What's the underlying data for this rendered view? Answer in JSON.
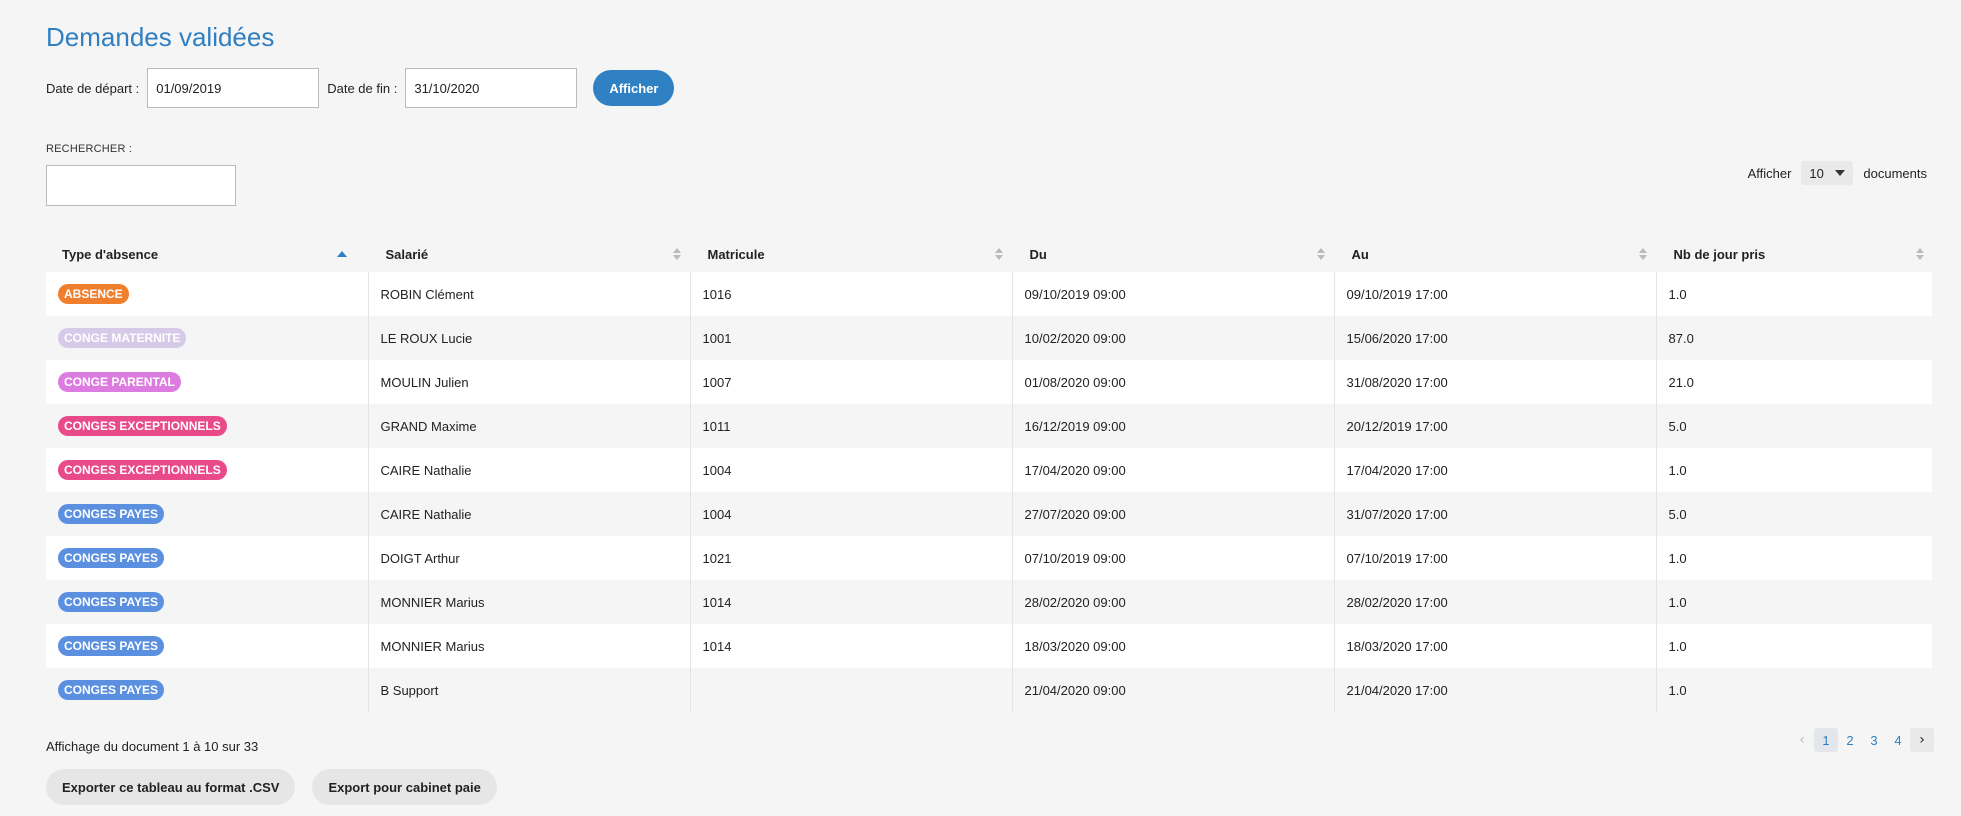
{
  "page_title": "Demandes validées",
  "filters": {
    "start_label": "Date de départ :",
    "start_value": "01/09/2019",
    "end_label": "Date de fin :",
    "end_value": "31/10/2020",
    "submit_label": "Afficher"
  },
  "search": {
    "label": "RECHERCHER :",
    "value": ""
  },
  "page_size": {
    "prefix": "Afficher",
    "value": "10",
    "suffix": "documents"
  },
  "columns": [
    "Type d'absence",
    "Salarié",
    "Matricule",
    "Du",
    "Au",
    "Nb de jour pris"
  ],
  "badge_colors": {
    "ABSENCE": "#f07f2d",
    "CONGE MATERNITE": "#d7c9e8",
    "CONGE PARENTAL": "#dc7ce0",
    "CONGES EXCEPTIONNELS": "#e84a8a",
    "CONGES PAYES": "#5b8fe0"
  },
  "rows": [
    {
      "type": "ABSENCE",
      "salarie": "ROBIN Clément",
      "matricule": "1016",
      "du": "09/10/2019 09:00",
      "au": "09/10/2019 17:00",
      "nb": "1.0"
    },
    {
      "type": "CONGE MATERNITE",
      "salarie": "LE ROUX Lucie",
      "matricule": "1001",
      "du": "10/02/2020 09:00",
      "au": "15/06/2020 17:00",
      "nb": "87.0"
    },
    {
      "type": "CONGE PARENTAL",
      "salarie": "MOULIN Julien",
      "matricule": "1007",
      "du": "01/08/2020 09:00",
      "au": "31/08/2020 17:00",
      "nb": "21.0"
    },
    {
      "type": "CONGES EXCEPTIONNELS",
      "salarie": "GRAND Maxime",
      "matricule": "1011",
      "du": "16/12/2019 09:00",
      "au": "20/12/2019 17:00",
      "nb": "5.0"
    },
    {
      "type": "CONGES EXCEPTIONNELS",
      "salarie": "CAIRE Nathalie",
      "matricule": "1004",
      "du": "17/04/2020 09:00",
      "au": "17/04/2020 17:00",
      "nb": "1.0"
    },
    {
      "type": "CONGES PAYES",
      "salarie": "CAIRE Nathalie",
      "matricule": "1004",
      "du": "27/07/2020 09:00",
      "au": "31/07/2020 17:00",
      "nb": "5.0"
    },
    {
      "type": "CONGES PAYES",
      "salarie": "DOIGT Arthur",
      "matricule": "1021",
      "du": "07/10/2019 09:00",
      "au": "07/10/2019 17:00",
      "nb": "1.0"
    },
    {
      "type": "CONGES PAYES",
      "salarie": "MONNIER Marius",
      "matricule": "1014",
      "du": "28/02/2020 09:00",
      "au": "28/02/2020 17:00",
      "nb": "1.0"
    },
    {
      "type": "CONGES PAYES",
      "salarie": "MONNIER Marius",
      "matricule": "1014",
      "du": "18/03/2020 09:00",
      "au": "18/03/2020 17:00",
      "nb": "1.0"
    },
    {
      "type": "CONGES PAYES",
      "salarie": "B Support",
      "matricule": "",
      "du": "21/04/2020 09:00",
      "au": "21/04/2020 17:00",
      "nb": "1.0"
    }
  ],
  "info": "Affichage du document 1 à 10 sur 33",
  "pagination": {
    "pages": [
      "1",
      "2",
      "3",
      "4"
    ],
    "current": "1",
    "prev_icon": "chevron-left-icon",
    "next_icon": "chevron-right-icon"
  },
  "exports": {
    "csv_label": "Exporter ce tableau au format .CSV",
    "payroll_label": "Export pour cabinet paie"
  }
}
